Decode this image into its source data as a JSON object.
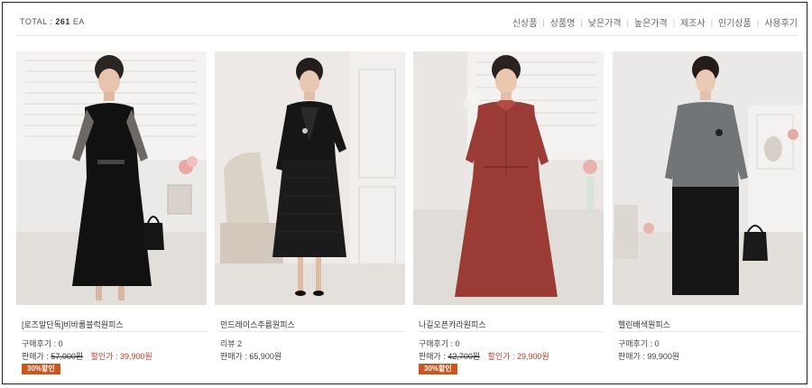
{
  "listing": {
    "total_label": "TOTAL : ",
    "total_count": "261",
    "total_unit": "EA",
    "sort_options": [
      "신상품",
      "상품명",
      "낮은가격",
      "높은가격",
      "제조사",
      "인기상품",
      "사용후기"
    ]
  },
  "products": [
    {
      "name": "[로즈말단독]비바룸블럭원피스",
      "review_label": "구매후기 : 0",
      "price_label": "판매가 : ",
      "price": "57,000원",
      "sale_label": "할인가 : ",
      "sale_price": "39,900원",
      "badge": "30%할인",
      "colors": {
        "dress": "#111111",
        "sleeve": "#6d6a66",
        "bg": "#eceae8"
      }
    },
    {
      "name": "민드레이스주름원피스",
      "review_label": "리뷰 2",
      "price_label": "판매가 : ",
      "price": "65,900원",
      "colors": {
        "dress": "#161616",
        "sleeve": "#161616",
        "bg": "#ece9e6"
      }
    },
    {
      "name": "나길오픈카라원피스",
      "review_label": "구매후기 : 0",
      "price_label": "판매가 : ",
      "price": "42,700원",
      "sale_label": "할인가 : ",
      "sale_price": "29,900원",
      "badge": "30%할인",
      "colors": {
        "dress": "#9b3b35",
        "sleeve": "#9b3b35",
        "bg": "#e9e6e3"
      }
    },
    {
      "name": "헬린배색원피스",
      "review_label": "구매후기 : 0",
      "price_label": "판매가 : ",
      "price": "99,900원",
      "colors": {
        "dress": "#151515",
        "sleeve": "#717578",
        "bg": "#ebe9e7"
      }
    }
  ]
}
